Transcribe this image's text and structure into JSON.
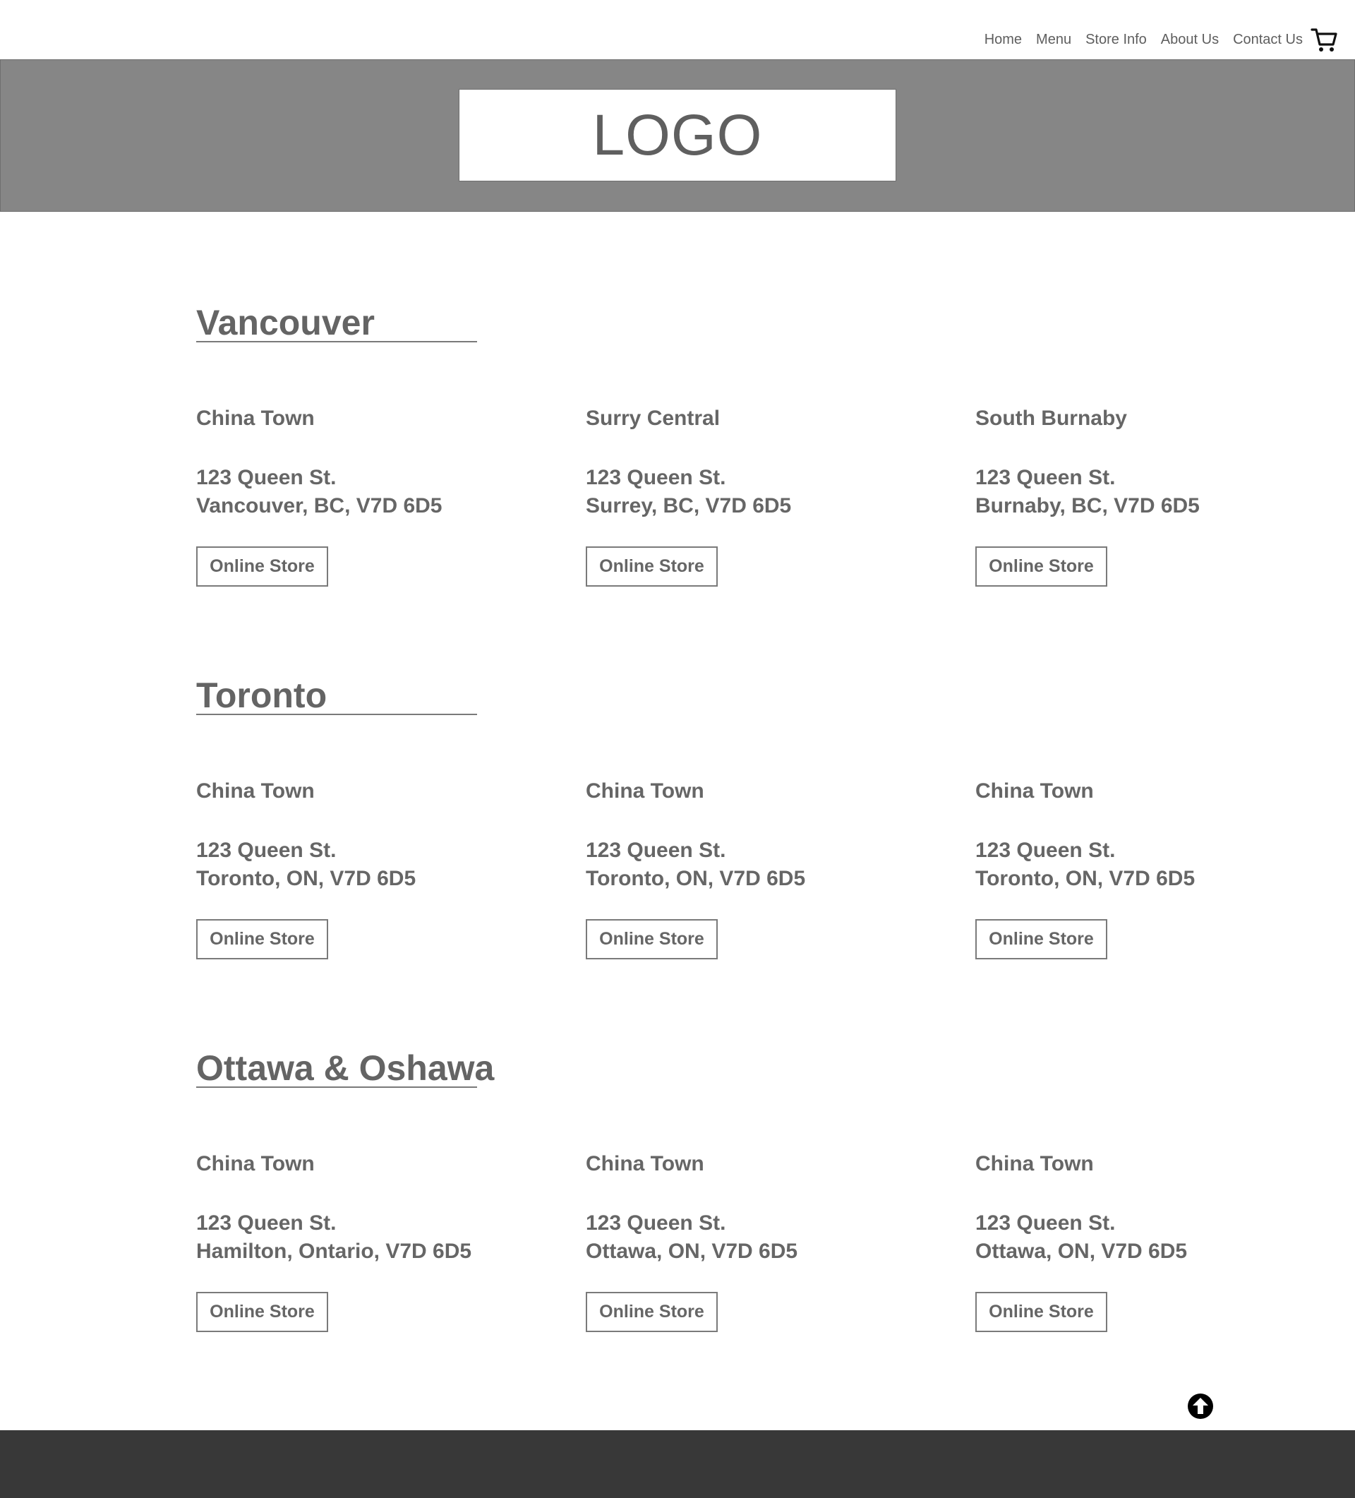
{
  "nav": {
    "items": [
      {
        "label": "Home"
      },
      {
        "label": "Menu"
      },
      {
        "label": "Store Info"
      },
      {
        "label": "About Us"
      },
      {
        "label": "Contact Us"
      }
    ],
    "cart_icon": "shopping-cart-icon"
  },
  "header": {
    "logo_text": "LOGO"
  },
  "regions": [
    {
      "title": "Vancouver",
      "stores": [
        {
          "name": "China Town",
          "address_line1": "123 Queen St.",
          "address_line2": "Vancouver, BC, V7D 6D5",
          "button_label": "Online Store"
        },
        {
          "name": "Surry Central",
          "address_line1": "123 Queen St.",
          "address_line2": "Surrey, BC, V7D 6D5",
          "button_label": "Online Store"
        },
        {
          "name": "South Burnaby",
          "address_line1": "123 Queen St.",
          "address_line2": "Burnaby, BC, V7D 6D5",
          "button_label": "Online Store"
        }
      ]
    },
    {
      "title": "Toronto",
      "stores": [
        {
          "name": "China Town",
          "address_line1": "123 Queen St.",
          "address_line2": "Toronto, ON, V7D 6D5",
          "button_label": "Online Store"
        },
        {
          "name": "China Town",
          "address_line1": "123 Queen St.",
          "address_line2": "Toronto, ON, V7D 6D5",
          "button_label": "Online Store"
        },
        {
          "name": "China Town",
          "address_line1": "123 Queen St.",
          "address_line2": "Toronto, ON, V7D 6D5",
          "button_label": "Online Store"
        }
      ]
    },
    {
      "title": "Ottawa & Oshawa",
      "stores": [
        {
          "name": "China Town",
          "address_line1": "123 Queen St.",
          "address_line2": "Hamilton, Ontario, V7D 6D5",
          "button_label": "Online Store"
        },
        {
          "name": "China Town",
          "address_line1": "123 Queen St.",
          "address_line2": "Ottawa, ON, V7D 6D5",
          "button_label": "Online Store"
        },
        {
          "name": "China Town",
          "address_line1": "123 Queen St.",
          "address_line2": "Ottawa, ON, V7D 6D5",
          "button_label": "Online Store"
        }
      ]
    }
  ],
  "back_to_top_icon": "arrow-up-circle-icon",
  "colors": {
    "banner": "#868686",
    "text": "#666666",
    "footer": "#383838"
  }
}
